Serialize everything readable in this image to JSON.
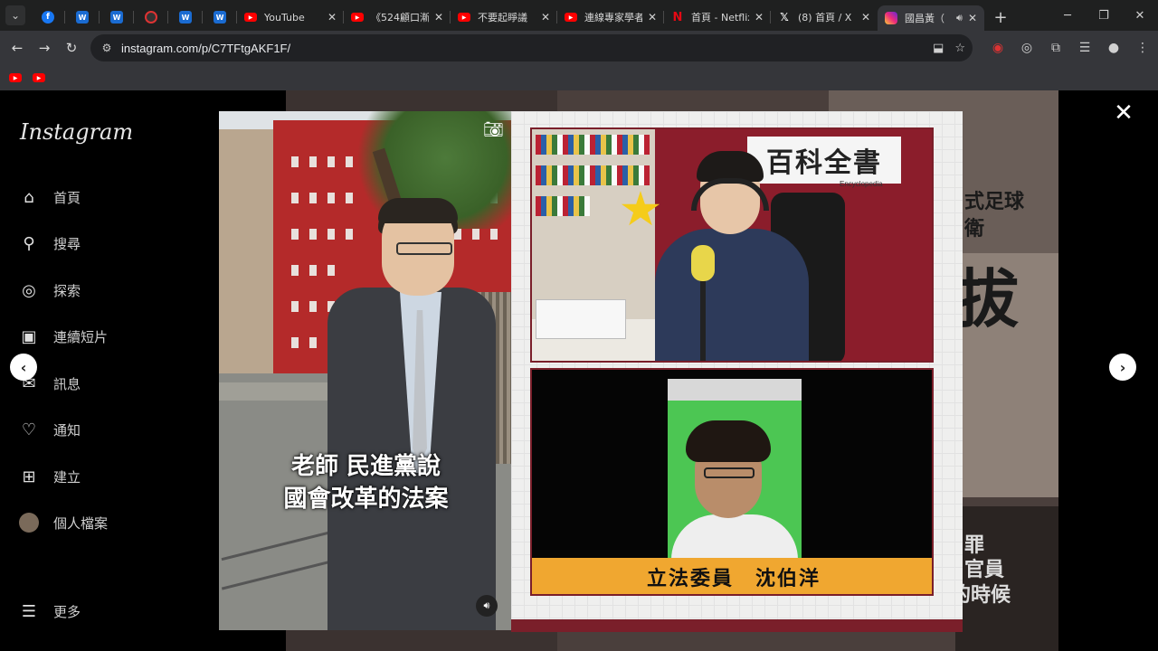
{
  "browser": {
    "tabs": [
      {
        "icon": "facebook-icon",
        "title": ""
      },
      {
        "icon": "wiki-icon",
        "title": ""
      },
      {
        "icon": "wiki-icon",
        "title": ""
      },
      {
        "icon": "record-icon",
        "title": ""
      },
      {
        "icon": "wiki-icon",
        "title": ""
      },
      {
        "icon": "wiki-icon",
        "title": ""
      },
      {
        "icon": "youtube-icon",
        "title": "YouTube"
      },
      {
        "icon": "youtube-icon",
        "title": "《524顧口漸"
      },
      {
        "icon": "youtube-icon",
        "title": "不要起睜議"
      },
      {
        "icon": "youtube-icon",
        "title": "連線專家學者"
      },
      {
        "icon": "netflix-icon",
        "title": "首頁 - Netflix"
      },
      {
        "icon": "x-icon",
        "title": "(8) 首頁 / X"
      },
      {
        "icon": "instagram-icon",
        "title": "國昌黃（"
      }
    ],
    "url": "instagram.com/p/C7TFtgAKF1F/"
  },
  "sidebar": {
    "logo": "Instagram",
    "items": [
      {
        "icon": "home-icon",
        "label": "首頁"
      },
      {
        "icon": "search-icon",
        "label": "搜尋"
      },
      {
        "icon": "explore-icon",
        "label": "探索"
      },
      {
        "icon": "reels-icon",
        "label": "連續短片"
      },
      {
        "icon": "messages-icon",
        "label": "訊息"
      },
      {
        "icon": "heart-icon",
        "label": "通知"
      },
      {
        "icon": "create-icon",
        "label": "建立"
      },
      {
        "icon": "avatar",
        "label": "個人檔案"
      }
    ],
    "more": "更多"
  },
  "post": {
    "subtitle_line1": "老師 民進黨說",
    "subtitle_line2": "國會改革的法案",
    "banner_text": "百科全書",
    "banner_sub": "Encyclopedia",
    "caption": "立法委員　沈伯洋"
  },
  "background": {
    "text_1": "式足球",
    "text_2": "衛",
    "text_3": "拔",
    "text_4": "罪",
    "text_5": "官員",
    "text_6": "的時候"
  }
}
